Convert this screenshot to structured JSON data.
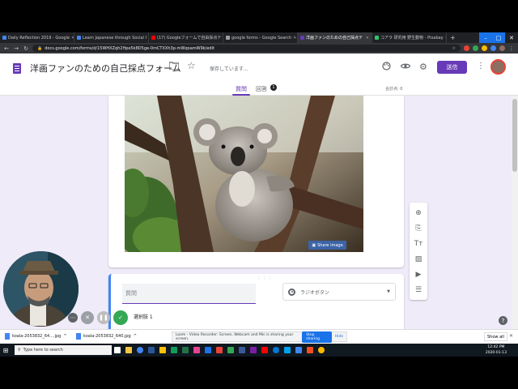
{
  "browser": {
    "tabs": [
      {
        "label": "Daily Reflection 2019 - Google",
        "color": "#4285f4",
        "active": false
      },
      {
        "label": "Learn Japanese through Social I",
        "color": "#4285f4",
        "active": false
      },
      {
        "label": "(17) Googleフォームで自由採点テ",
        "color": "#ff0000",
        "active": false
      },
      {
        "label": "google forms - Google Search",
        "color": "#9aa0a6",
        "active": false
      },
      {
        "label": "洋画ファンのための自己採点テ",
        "color": "#673ab7",
        "active": true
      },
      {
        "label": "コアラ 研究用 野生動物 - Pixabay",
        "color": "#2ec66d",
        "active": false
      }
    ],
    "new_tab": "+",
    "url": "docs.google.com/forms/d/15WHXZqh2Hpe5k8D5ge-0mCTXXh3p-mWqoamW9k/edit"
  },
  "form": {
    "title": "洋画ファンのための自己採点フォーム",
    "saving": "保存しています...",
    "send": "送信",
    "tabs": {
      "questions": "質問",
      "responses": "回答",
      "response_count": "1"
    },
    "score": "合計点: 0",
    "share_image": "Share image",
    "question_placeholder": "質問",
    "question_type": "ラジオボタン",
    "option_1": "選択肢 1",
    "drag_handle": "⋮⋮⋮",
    "accent": "#673ab7"
  },
  "downloads": {
    "items": [
      "koala-2053832_64....jpg",
      "koala-2053832_640.jpg"
    ],
    "loom_message": "Loom - Video Recorder: Screen, Webcam and Mic is sharing your screen.",
    "stop_sharing": "Stop sharing",
    "hide": "Hide",
    "show_all": "Show all"
  },
  "taskbar": {
    "search_placeholder": "Type here to search",
    "time": "12:42 PM",
    "date": "2020-01-13"
  }
}
